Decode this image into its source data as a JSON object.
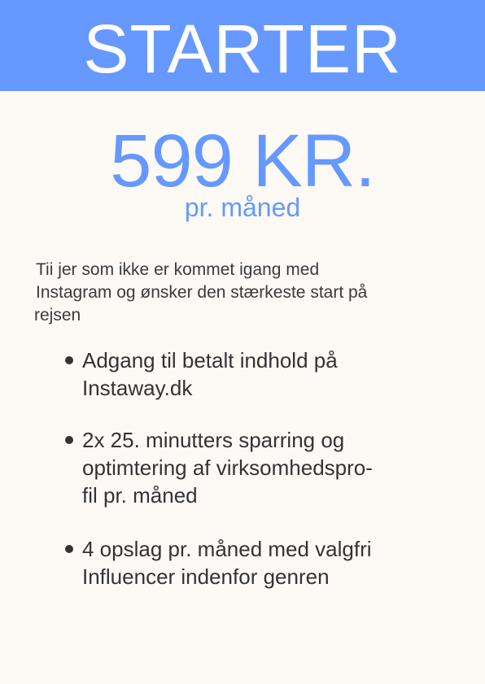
{
  "header": {
    "title": "STARTER",
    "background": "#6699ff"
  },
  "pricing": {
    "price": "599 KR.",
    "period": "pr. måned",
    "accent": "#6699ff"
  },
  "intro": {
    "lines": [
      " Tii jer som ikke er kommet igang med",
      " Instagram og ønsker den stærkeste start på",
      "rejsen"
    ]
  },
  "features": [
    {
      "lines": [
        "Adgang til betalt indhold på",
        "Instaway.dk"
      ]
    },
    {
      "lines": [
        "2x 25. minutters sparring og",
        "optimtering af virksomhedspro-",
        "fil pr. måned"
      ]
    },
    {
      "lines": [
        "4 opslag pr. måned med valgfri",
        "Influencer indenfor genren"
      ]
    }
  ]
}
